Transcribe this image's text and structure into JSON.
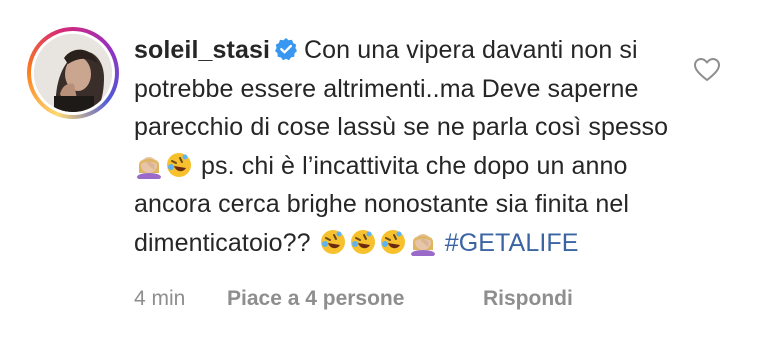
{
  "comment": {
    "username": "soleil_stasi",
    "text_1": "Con una vipera davanti non si potrebbe essere altrimenti..ma Deve saperne parecchio di cose lassù se ne parla così spesso",
    "text_2": "ps. chi è l’incattivita che dopo un anno ancora cerca brighe nonostante sia finita nel dimenticatoio??",
    "hashtag": "#GETALIFE",
    "verified_icon": "verified-badge-icon",
    "emojis": [
      "woman-facepalming-emoji",
      "rolling-on-the-floor-laughing-emoji"
    ],
    "accent_color": "#3b64a3"
  },
  "meta": {
    "time": "4 min",
    "likes": "Piace a 4 persone",
    "reply": "Rispondi"
  },
  "actions": {
    "like_icon": "heart-outline-icon"
  }
}
